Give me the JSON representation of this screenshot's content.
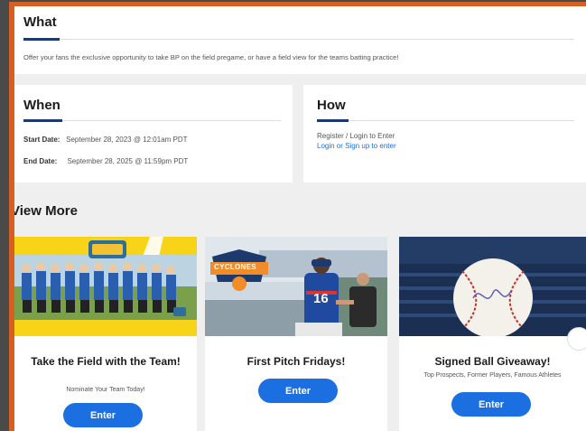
{
  "what": {
    "title": "What",
    "description": "Offer your fans the exclusive opportunity to take BP on the field pregame, or have a field view for the teams batting practice!"
  },
  "when": {
    "title": "When",
    "start_label": "Start Date:",
    "start_value": "September 28, 2023 @ 12:01am PDT",
    "end_label": "End Date:",
    "end_value": "September 28, 2025 @ 11:59pm PDT"
  },
  "how": {
    "title": "How",
    "text": "Register / Login to Enter",
    "link": "Login or Sign up to enter"
  },
  "view_more": {
    "title": "View More",
    "cards": [
      {
        "title": "Take the Field with the Team!",
        "subtitle": "Nominate Your Team Today!",
        "button": "Enter"
      },
      {
        "title": "First Pitch Fridays!",
        "subtitle": "",
        "button": "Enter",
        "logo_text": "CYCLONES",
        "jersey_number": "16"
      },
      {
        "title": "Signed Ball Giveaway!",
        "subtitle": "Top Prospects, Former Players, Famous Athletes",
        "button": "Enter"
      }
    ]
  },
  "colors": {
    "frame": "#d65f22",
    "accent_bar": "#1c3a6e",
    "link": "#1c6fe0",
    "button": "#1c6fe0",
    "promo_yellow": "#f7d417"
  }
}
